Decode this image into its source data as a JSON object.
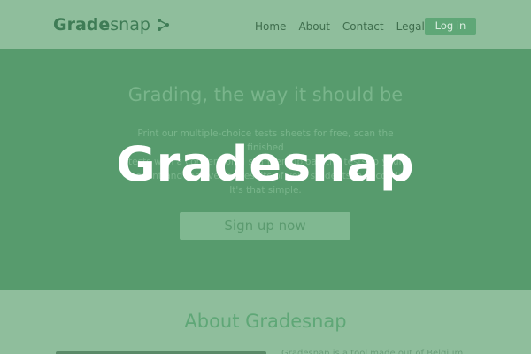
{
  "header": {
    "logo_bold": "Grade",
    "logo_light": "snap",
    "nav": [
      "Home",
      "About",
      "Contact",
      "Legal"
    ],
    "login_label": "Log in"
  },
  "hero": {
    "title": "Grading, the way it should be",
    "text_line1": "Print our multiple-choice tests sheets for free, scan the finished",
    "text_line2": "tests with a conventional scanner, upload the tests to your",
    "text_line3": "account and receive the results of your students in seconds.",
    "text_line4": "It's that simple.",
    "signup_label": "Sign up now"
  },
  "about": {
    "title": "About Gradesnap",
    "text": "Gradesnap is a tool made out of Belgium"
  },
  "overlay": {
    "brand": "Gradesnap"
  },
  "colors": {
    "header_bg": "#8fbe9c",
    "hero_bg": "#579b6d",
    "accent": "#5fa777",
    "overlay_text": "#ffffff"
  }
}
